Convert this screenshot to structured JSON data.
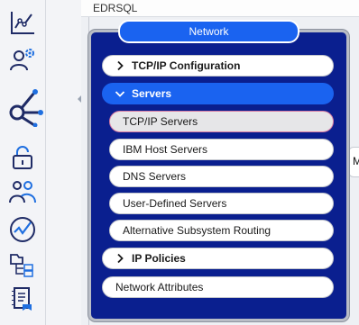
{
  "header": {
    "system_name": "EDRSQL"
  },
  "rail": {
    "icons": [
      "analytics-icon",
      "configuration-icon",
      "network-icon",
      "security-icon",
      "users-groups-icon",
      "performance-icon",
      "file-systems-icon",
      "journal-icon"
    ],
    "active": "network-icon"
  },
  "popup": {
    "title": "Network",
    "items": [
      {
        "label": "TCP/IP Configuration",
        "state": "collapsed"
      },
      {
        "label": "Servers",
        "state": "expanded"
      },
      {
        "label": "TCP/IP Servers",
        "state": "selected"
      },
      {
        "label": "IBM Host Servers"
      },
      {
        "label": "DNS Servers"
      },
      {
        "label": "User-Defined Servers"
      },
      {
        "label": "Alternative Subsystem Routing"
      },
      {
        "label": "IP Policies",
        "state": "collapsed"
      },
      {
        "label": "Network Attributes"
      }
    ]
  },
  "right_tab": {
    "label": "M"
  },
  "colors": {
    "popup_bg": "#0a1f8f",
    "accent": "#1a63f0",
    "selected_border": "#d77aa2"
  }
}
